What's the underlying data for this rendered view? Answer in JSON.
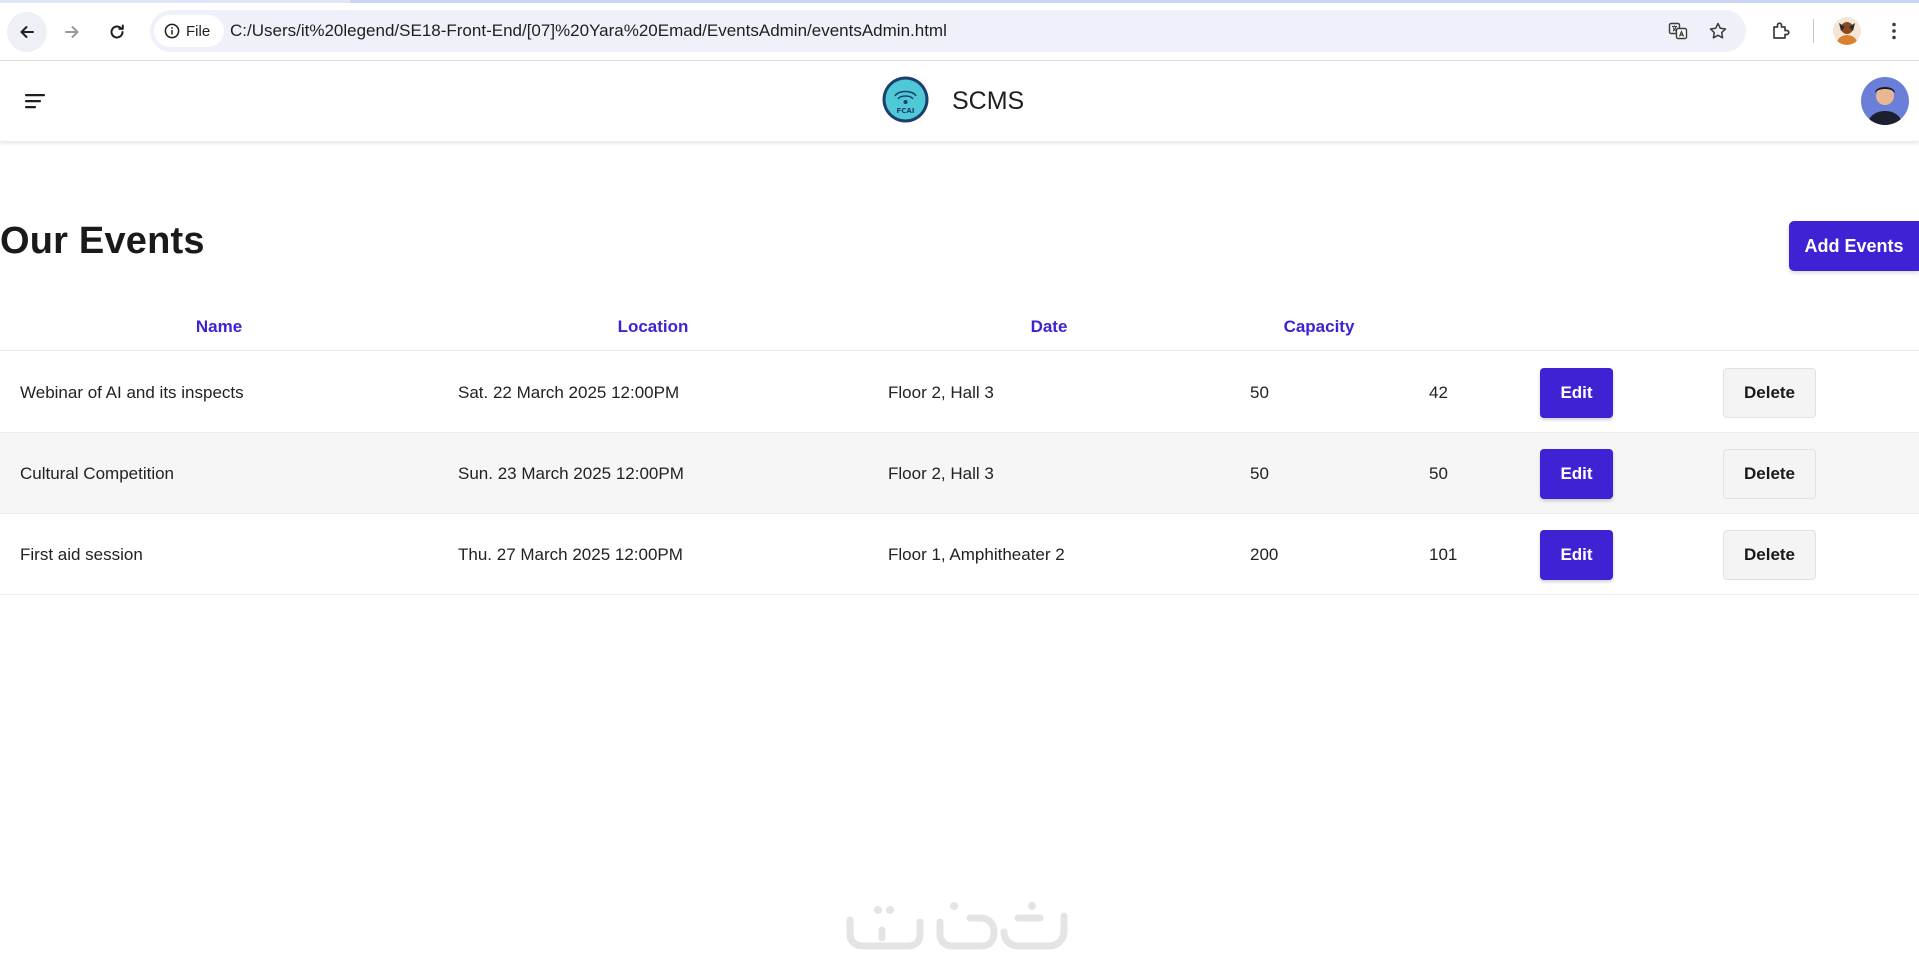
{
  "browser": {
    "file_chip": "File",
    "url": "C:/Users/it%20legend/SE18-Front-End/[07]%20Yara%20Emad/EventsAdmin/eventsAdmin.html"
  },
  "header": {
    "logo_text": "FCAI",
    "brand": "SCMS"
  },
  "page": {
    "title": "Our Events",
    "add_button": "Add Events"
  },
  "table": {
    "columns": [
      "Name",
      "Location",
      "Date",
      "Capacity"
    ],
    "rows": [
      {
        "name": "Webinar of AI and its inspects",
        "date": "Sat. 22 March 2025 12:00PM",
        "location": "Floor 2, Hall 3",
        "capacity": "50",
        "registered": "42",
        "edit": "Edit",
        "delete": "Delete"
      },
      {
        "name": "Cultural Competition",
        "date": "Sun. 23 March 2025 12:00PM",
        "location": "Floor 2, Hall 3",
        "capacity": "50",
        "registered": "50",
        "edit": "Edit",
        "delete": "Delete"
      },
      {
        "name": "First aid session",
        "date": "Thu. 27 March 2025 12:00PM",
        "location": "Floor 1, Amphitheater 2",
        "capacity": "200",
        "registered": "101",
        "edit": "Edit",
        "delete": "Delete"
      }
    ]
  },
  "colors": {
    "accent": "#3f22d4",
    "row_alt": "#f6f6f6"
  }
}
